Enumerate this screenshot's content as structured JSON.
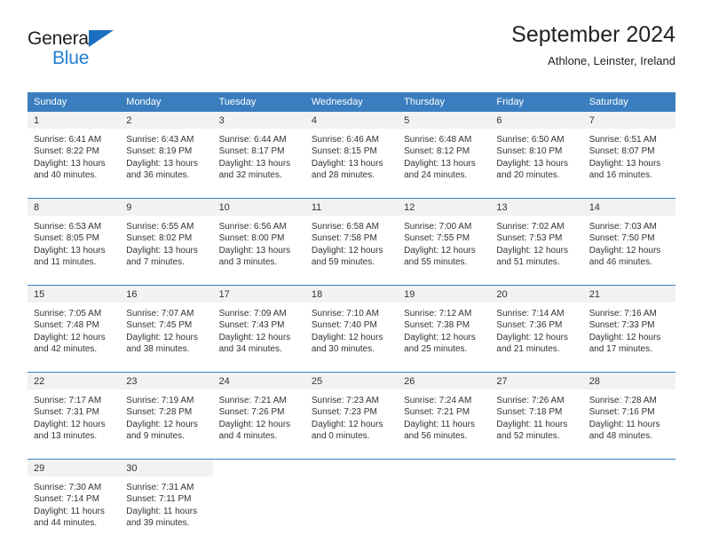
{
  "logo": {
    "text_top": "General",
    "text_bottom": "Blue",
    "icon": "triangle-icon",
    "color_dark": "#231f20",
    "color_blue": "#2380d4"
  },
  "header": {
    "title": "September 2024",
    "subtitle": "Athlone, Leinster, Ireland"
  },
  "theme": {
    "header_bg": "#3b7ebf",
    "daynum_bg": "#f2f2f2",
    "rule_color": "#3b7ebf",
    "text": "#333333"
  },
  "weekdays": [
    "Sunday",
    "Monday",
    "Tuesday",
    "Wednesday",
    "Thursday",
    "Friday",
    "Saturday"
  ],
  "weeks": [
    [
      {
        "day": "1",
        "sunrise": "Sunrise: 6:41 AM",
        "sunset": "Sunset: 8:22 PM",
        "daylight1": "Daylight: 13 hours",
        "daylight2": "and 40 minutes."
      },
      {
        "day": "2",
        "sunrise": "Sunrise: 6:43 AM",
        "sunset": "Sunset: 8:19 PM",
        "daylight1": "Daylight: 13 hours",
        "daylight2": "and 36 minutes."
      },
      {
        "day": "3",
        "sunrise": "Sunrise: 6:44 AM",
        "sunset": "Sunset: 8:17 PM",
        "daylight1": "Daylight: 13 hours",
        "daylight2": "and 32 minutes."
      },
      {
        "day": "4",
        "sunrise": "Sunrise: 6:46 AM",
        "sunset": "Sunset: 8:15 PM",
        "daylight1": "Daylight: 13 hours",
        "daylight2": "and 28 minutes."
      },
      {
        "day": "5",
        "sunrise": "Sunrise: 6:48 AM",
        "sunset": "Sunset: 8:12 PM",
        "daylight1": "Daylight: 13 hours",
        "daylight2": "and 24 minutes."
      },
      {
        "day": "6",
        "sunrise": "Sunrise: 6:50 AM",
        "sunset": "Sunset: 8:10 PM",
        "daylight1": "Daylight: 13 hours",
        "daylight2": "and 20 minutes."
      },
      {
        "day": "7",
        "sunrise": "Sunrise: 6:51 AM",
        "sunset": "Sunset: 8:07 PM",
        "daylight1": "Daylight: 13 hours",
        "daylight2": "and 16 minutes."
      }
    ],
    [
      {
        "day": "8",
        "sunrise": "Sunrise: 6:53 AM",
        "sunset": "Sunset: 8:05 PM",
        "daylight1": "Daylight: 13 hours",
        "daylight2": "and 11 minutes."
      },
      {
        "day": "9",
        "sunrise": "Sunrise: 6:55 AM",
        "sunset": "Sunset: 8:02 PM",
        "daylight1": "Daylight: 13 hours",
        "daylight2": "and 7 minutes."
      },
      {
        "day": "10",
        "sunrise": "Sunrise: 6:56 AM",
        "sunset": "Sunset: 8:00 PM",
        "daylight1": "Daylight: 13 hours",
        "daylight2": "and 3 minutes."
      },
      {
        "day": "11",
        "sunrise": "Sunrise: 6:58 AM",
        "sunset": "Sunset: 7:58 PM",
        "daylight1": "Daylight: 12 hours",
        "daylight2": "and 59 minutes."
      },
      {
        "day": "12",
        "sunrise": "Sunrise: 7:00 AM",
        "sunset": "Sunset: 7:55 PM",
        "daylight1": "Daylight: 12 hours",
        "daylight2": "and 55 minutes."
      },
      {
        "day": "13",
        "sunrise": "Sunrise: 7:02 AM",
        "sunset": "Sunset: 7:53 PM",
        "daylight1": "Daylight: 12 hours",
        "daylight2": "and 51 minutes."
      },
      {
        "day": "14",
        "sunrise": "Sunrise: 7:03 AM",
        "sunset": "Sunset: 7:50 PM",
        "daylight1": "Daylight: 12 hours",
        "daylight2": "and 46 minutes."
      }
    ],
    [
      {
        "day": "15",
        "sunrise": "Sunrise: 7:05 AM",
        "sunset": "Sunset: 7:48 PM",
        "daylight1": "Daylight: 12 hours",
        "daylight2": "and 42 minutes."
      },
      {
        "day": "16",
        "sunrise": "Sunrise: 7:07 AM",
        "sunset": "Sunset: 7:45 PM",
        "daylight1": "Daylight: 12 hours",
        "daylight2": "and 38 minutes."
      },
      {
        "day": "17",
        "sunrise": "Sunrise: 7:09 AM",
        "sunset": "Sunset: 7:43 PM",
        "daylight1": "Daylight: 12 hours",
        "daylight2": "and 34 minutes."
      },
      {
        "day": "18",
        "sunrise": "Sunrise: 7:10 AM",
        "sunset": "Sunset: 7:40 PM",
        "daylight1": "Daylight: 12 hours",
        "daylight2": "and 30 minutes."
      },
      {
        "day": "19",
        "sunrise": "Sunrise: 7:12 AM",
        "sunset": "Sunset: 7:38 PM",
        "daylight1": "Daylight: 12 hours",
        "daylight2": "and 25 minutes."
      },
      {
        "day": "20",
        "sunrise": "Sunrise: 7:14 AM",
        "sunset": "Sunset: 7:36 PM",
        "daylight1": "Daylight: 12 hours",
        "daylight2": "and 21 minutes."
      },
      {
        "day": "21",
        "sunrise": "Sunrise: 7:16 AM",
        "sunset": "Sunset: 7:33 PM",
        "daylight1": "Daylight: 12 hours",
        "daylight2": "and 17 minutes."
      }
    ],
    [
      {
        "day": "22",
        "sunrise": "Sunrise: 7:17 AM",
        "sunset": "Sunset: 7:31 PM",
        "daylight1": "Daylight: 12 hours",
        "daylight2": "and 13 minutes."
      },
      {
        "day": "23",
        "sunrise": "Sunrise: 7:19 AM",
        "sunset": "Sunset: 7:28 PM",
        "daylight1": "Daylight: 12 hours",
        "daylight2": "and 9 minutes."
      },
      {
        "day": "24",
        "sunrise": "Sunrise: 7:21 AM",
        "sunset": "Sunset: 7:26 PM",
        "daylight1": "Daylight: 12 hours",
        "daylight2": "and 4 minutes."
      },
      {
        "day": "25",
        "sunrise": "Sunrise: 7:23 AM",
        "sunset": "Sunset: 7:23 PM",
        "daylight1": "Daylight: 12 hours",
        "daylight2": "and 0 minutes."
      },
      {
        "day": "26",
        "sunrise": "Sunrise: 7:24 AM",
        "sunset": "Sunset: 7:21 PM",
        "daylight1": "Daylight: 11 hours",
        "daylight2": "and 56 minutes."
      },
      {
        "day": "27",
        "sunrise": "Sunrise: 7:26 AM",
        "sunset": "Sunset: 7:18 PM",
        "daylight1": "Daylight: 11 hours",
        "daylight2": "and 52 minutes."
      },
      {
        "day": "28",
        "sunrise": "Sunrise: 7:28 AM",
        "sunset": "Sunset: 7:16 PM",
        "daylight1": "Daylight: 11 hours",
        "daylight2": "and 48 minutes."
      }
    ],
    [
      {
        "day": "29",
        "sunrise": "Sunrise: 7:30 AM",
        "sunset": "Sunset: 7:14 PM",
        "daylight1": "Daylight: 11 hours",
        "daylight2": "and 44 minutes."
      },
      {
        "day": "30",
        "sunrise": "Sunrise: 7:31 AM",
        "sunset": "Sunset: 7:11 PM",
        "daylight1": "Daylight: 11 hours",
        "daylight2": "and 39 minutes."
      },
      {
        "day": "",
        "sunrise": "",
        "sunset": "",
        "daylight1": "",
        "daylight2": ""
      },
      {
        "day": "",
        "sunrise": "",
        "sunset": "",
        "daylight1": "",
        "daylight2": ""
      },
      {
        "day": "",
        "sunrise": "",
        "sunset": "",
        "daylight1": "",
        "daylight2": ""
      },
      {
        "day": "",
        "sunrise": "",
        "sunset": "",
        "daylight1": "",
        "daylight2": ""
      },
      {
        "day": "",
        "sunrise": "",
        "sunset": "",
        "daylight1": "",
        "daylight2": ""
      }
    ]
  ]
}
